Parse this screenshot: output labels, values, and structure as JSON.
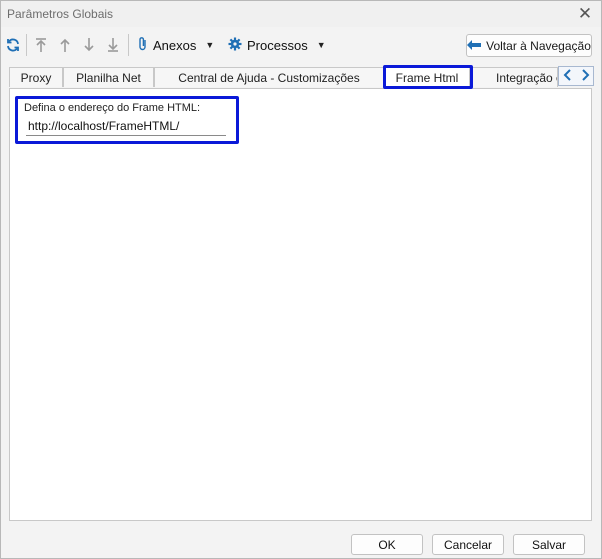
{
  "window": {
    "title": "Parâmetros Globais"
  },
  "toolbar": {
    "refresh_icon": "refresh-icon",
    "menus": [
      {
        "label": "Anexos",
        "icon": "paperclip-icon"
      },
      {
        "label": "Processos",
        "icon": "gear-icon"
      }
    ],
    "back_nav_label": "Voltar à Navegação"
  },
  "tabs": [
    {
      "label": "Proxy"
    },
    {
      "label": "Planilha Net"
    },
    {
      "label": "Central de Ajuda - Customizações"
    },
    {
      "label": "Frame Html",
      "active": true
    },
    {
      "label": "Integração c"
    }
  ],
  "frame_html": {
    "label": "Defina o endereço do Frame HTML:",
    "value": "http://localhost/FrameHTML/"
  },
  "footer": {
    "ok_label": "OK",
    "cancel_label": "Cancelar",
    "save_label": "Salvar"
  },
  "colors": {
    "highlight": "#0a19d8",
    "accent": "#1f6fb5"
  }
}
